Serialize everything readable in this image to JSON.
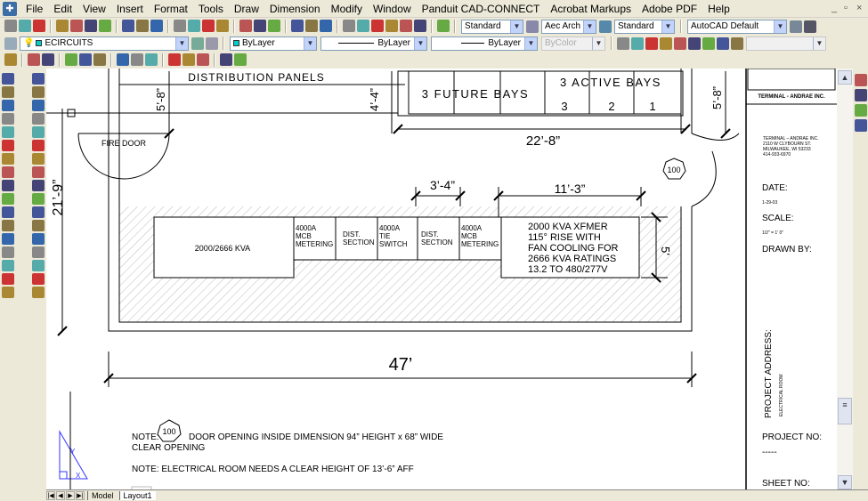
{
  "menubar": {
    "items": [
      "File",
      "Edit",
      "View",
      "Insert",
      "Format",
      "Tools",
      "Draw",
      "Dimension",
      "Modify",
      "Window",
      "Panduit CAD-CONNECT",
      "Acrobat Markups",
      "Adobe PDF",
      "Help"
    ]
  },
  "window_controls": [
    "_",
    "▫",
    "×"
  ],
  "toolbar1": {
    "text_style": "Standard",
    "dim_style": "Aec Arch I",
    "table_style": "Standard",
    "workspace": "AutoCAD Default"
  },
  "toolbar2": {
    "layer": "ECIRCUITS",
    "color": "ByLayer",
    "linetype": "ByLayer",
    "lineweight": "ByLayer",
    "plotstyle": "ByColor"
  },
  "drawing": {
    "distribution_panels": "DISTRIBUTION PANELS",
    "future_bays": "3 FUTURE BAYS",
    "active_bays": "3 ACTIVE BAYS",
    "bay_numbers": [
      "3",
      "2",
      "1"
    ],
    "dim_22_8": "22’-8”",
    "dim_5_8_left": "5’-8”",
    "dim_4_4": "4’-4”",
    "dim_5_8_right": "5’-8”",
    "dim_21_9": "21’-9”",
    "dim_3_4": "3’-4”",
    "dim_11_3": "11’-3”",
    "dim_5": "5’",
    "dim_47": "47’",
    "fire_door": "FIRE DOOR",
    "door_tag": "100",
    "kva_label": "2000/2666  KVA",
    "sections": [
      [
        "4000A",
        "MCB",
        "METERING"
      ],
      [
        "DIST.",
        "SECTION"
      ],
      [
        "4000A",
        "TIE",
        "SWITCH"
      ],
      [
        "DIST.",
        "SECTION"
      ],
      [
        "4000A",
        "MCB",
        "METERING"
      ]
    ],
    "xfmer": [
      "2000  KVA  XFMER",
      "115° RISE  WITH",
      "FAN  COOLING  FOR",
      "2666  KVA  RATINGS",
      "13.2  TO  480/277V"
    ],
    "note1_prefix": "NOTE:",
    "note1_tag": "100",
    "note1_text": "DOOR  OPENING  INSIDE  DIMENSION  94”  HEIGHT  x  68”  WIDE",
    "note1_line2": "CLEAR  OPENING",
    "note2": "NOTE:  ELECTRICAL  ROOM  NEEDS  A  CLEAR  HEIGHT  OF  13’-6”  AFF",
    "ucs_y": "Y",
    "ucs_x": "X"
  },
  "titleblock": {
    "logo_text": "TERMINAL - ANDRAE INC.",
    "address": [
      "TERMINAL – ANDRAE INC.",
      "2110 W CLYBOURN ST.",
      "MILWAUKEE, WI 53233",
      "414-933-6970"
    ],
    "date_label": "DATE:",
    "date_value": "1-29-03",
    "scale_label": "SCALE:",
    "scale_value": "1/2\" = 1' 0\"",
    "drawn_by_label": "DRAWN BY:",
    "project_address_label": "PROJECT ADDRESS:",
    "project_address_value": "ELECTRICAL ROOM",
    "project_no_label": "PROJECT NO:",
    "project_no_value": "-----",
    "sheet_no_label": "SHEET NO:"
  },
  "tabs": {
    "nav": [
      "|◀",
      "◀",
      "▶",
      "▶|"
    ],
    "items": [
      "Model",
      "Layout1"
    ],
    "active": "Layout1"
  },
  "colors": {
    "ucs": "#3333ff",
    "hatch": "#999999",
    "toolbar_bg": "#ece9d8"
  }
}
